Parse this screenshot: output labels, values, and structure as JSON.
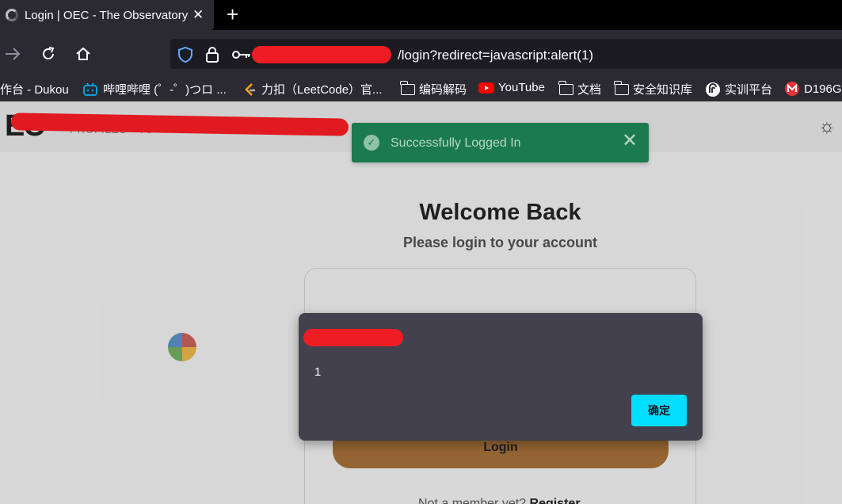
{
  "browser": {
    "tab_title": "Login | OEC - The Observatory of Economic Complexity",
    "url_visible": "/login?redirect=javascript:alert(1)",
    "bookmarks": [
      {
        "label": "作台 - Dukou",
        "icon": "none"
      },
      {
        "label": "哔哩哔哩 (゜-゜)つロ ...",
        "icon": "bilibili-icon"
      },
      {
        "label": "力扣（LeetCode）官...",
        "icon": "leetcode-icon"
      },
      {
        "label": "编码解码",
        "icon": "folder-icon"
      },
      {
        "label": "YouTube",
        "icon": "youtube-icon"
      },
      {
        "label": "文档",
        "icon": "folder-icon"
      },
      {
        "label": "安全知识库",
        "icon": "folder-icon"
      },
      {
        "label": "实训平台",
        "icon": "site-icon"
      },
      {
        "label": "D196G",
        "icon": "m-icon"
      }
    ]
  },
  "site": {
    "logo": "EC",
    "welcome_title": "Welcome Back",
    "welcome_subtitle": "Please login to your account",
    "login_button": "Login",
    "footer_prompt": "Not a member yet?",
    "footer_register": "Register"
  },
  "toast": {
    "message": "Successfully Logged In",
    "close_symbol": "✕"
  },
  "alert": {
    "message": "1",
    "ok_label": "确定"
  },
  "colors": {
    "toast_bg": "#1c7a4f",
    "alert_button": "#00ddff",
    "redaction": "#ee1c23"
  }
}
